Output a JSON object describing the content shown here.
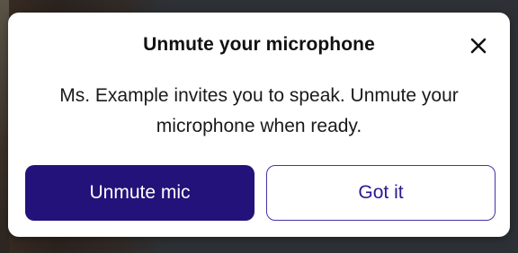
{
  "dialog": {
    "title": "Unmute your microphone",
    "message": "Ms. Example invites you to speak. Unmute your microphone when ready.",
    "close_icon": "close-icon",
    "primary_button_label": "Unmute mic",
    "secondary_button_label": "Got it"
  },
  "colors": {
    "primary_button_bg": "#22127a",
    "secondary_button_border": "#4433a6",
    "secondary_button_text": "#2a1a90",
    "dialog_bg": "#ffffff",
    "backdrop": "#2d3135"
  }
}
